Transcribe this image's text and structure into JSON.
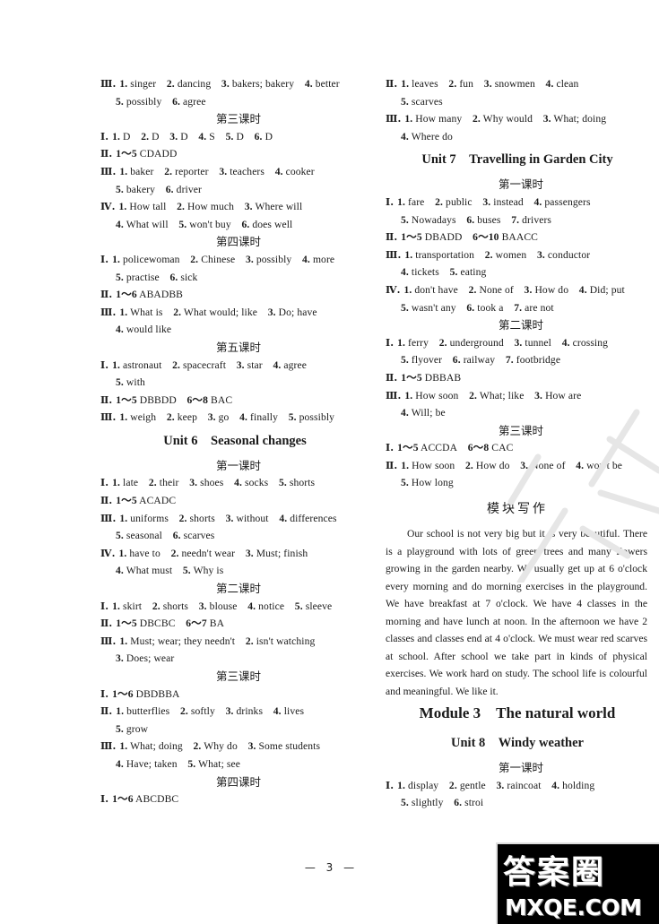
{
  "left": [
    {
      "type": "line",
      "roman": "Ⅲ",
      "items": [
        [
          "1.",
          "singer"
        ],
        [
          "2.",
          "dancing"
        ],
        [
          "3.",
          "bakers; bakery"
        ],
        [
          "4.",
          "better"
        ]
      ]
    },
    {
      "type": "cont",
      "items": [
        [
          "5.",
          "possibly"
        ],
        [
          "6.",
          "agree"
        ]
      ]
    },
    {
      "type": "lesson",
      "text": "第三课时"
    },
    {
      "type": "line",
      "roman": "Ⅰ",
      "items": [
        [
          "1.",
          "D"
        ],
        [
          "2.",
          "D"
        ],
        [
          "3.",
          "D"
        ],
        [
          "4.",
          "S"
        ],
        [
          "5.",
          "D"
        ],
        [
          "6.",
          "D"
        ]
      ]
    },
    {
      "type": "line",
      "roman": "Ⅱ",
      "items": [
        [
          "1～5",
          "CDADD"
        ]
      ]
    },
    {
      "type": "line",
      "roman": "Ⅲ",
      "items": [
        [
          "1.",
          "baker"
        ],
        [
          "2.",
          "reporter"
        ],
        [
          "3.",
          "teachers"
        ],
        [
          "4.",
          "cooker"
        ]
      ]
    },
    {
      "type": "cont",
      "items": [
        [
          "5.",
          "bakery"
        ],
        [
          "6.",
          "driver"
        ]
      ]
    },
    {
      "type": "line",
      "roman": "Ⅳ",
      "items": [
        [
          "1.",
          "How tall"
        ],
        [
          "2.",
          "How much"
        ],
        [
          "3.",
          "Where will"
        ]
      ]
    },
    {
      "type": "cont",
      "items": [
        [
          "4.",
          "What will"
        ],
        [
          "5.",
          "won't buy"
        ],
        [
          "6.",
          "does well"
        ]
      ]
    },
    {
      "type": "lesson",
      "text": "第四课时"
    },
    {
      "type": "line",
      "roman": "Ⅰ",
      "items": [
        [
          "1.",
          "policewoman"
        ],
        [
          "2.",
          "Chinese"
        ],
        [
          "3.",
          "possibly"
        ],
        [
          "4.",
          "more"
        ]
      ]
    },
    {
      "type": "cont",
      "items": [
        [
          "5.",
          "practise"
        ],
        [
          "6.",
          "sick"
        ]
      ]
    },
    {
      "type": "line",
      "roman": "Ⅱ",
      "items": [
        [
          "1～6",
          "ABADBB"
        ]
      ]
    },
    {
      "type": "line",
      "roman": "Ⅲ",
      "items": [
        [
          "1.",
          "What is"
        ],
        [
          "2.",
          "What would; like"
        ],
        [
          "3.",
          "Do; have"
        ]
      ]
    },
    {
      "type": "cont",
      "items": [
        [
          "4.",
          "would like"
        ]
      ]
    },
    {
      "type": "lesson",
      "text": "第五课时"
    },
    {
      "type": "line",
      "roman": "Ⅰ",
      "items": [
        [
          "1.",
          "astronaut"
        ],
        [
          "2.",
          "spacecraft"
        ],
        [
          "3.",
          "star"
        ],
        [
          "4.",
          "agree"
        ]
      ]
    },
    {
      "type": "cont",
      "items": [
        [
          "5.",
          "with"
        ]
      ]
    },
    {
      "type": "line",
      "roman": "Ⅱ",
      "items": [
        [
          "1～5",
          "DBBDD"
        ],
        [
          "6～8",
          "BAC"
        ]
      ]
    },
    {
      "type": "line",
      "roman": "Ⅲ",
      "items": [
        [
          "1.",
          "weigh"
        ],
        [
          "2.",
          "keep"
        ],
        [
          "3.",
          "go"
        ],
        [
          "4.",
          "finally"
        ],
        [
          "5.",
          "possibly"
        ]
      ]
    },
    {
      "type": "unit",
      "text": "Unit 6　Seasonal changes"
    },
    {
      "type": "lesson",
      "text": "第一课时"
    },
    {
      "type": "line",
      "roman": "Ⅰ",
      "items": [
        [
          "1.",
          "late"
        ],
        [
          "2.",
          "their"
        ],
        [
          "3.",
          "shoes"
        ],
        [
          "4.",
          "socks"
        ],
        [
          "5.",
          "shorts"
        ]
      ]
    },
    {
      "type": "line",
      "roman": "Ⅱ",
      "items": [
        [
          "1～5",
          "ACADC"
        ]
      ]
    },
    {
      "type": "line",
      "roman": "Ⅲ",
      "items": [
        [
          "1.",
          "uniforms"
        ],
        [
          "2.",
          "shorts"
        ],
        [
          "3.",
          "without"
        ],
        [
          "4.",
          "differences"
        ]
      ]
    },
    {
      "type": "cont",
      "items": [
        [
          "5.",
          "seasonal"
        ],
        [
          "6.",
          "scarves"
        ]
      ]
    },
    {
      "type": "line",
      "roman": "Ⅳ",
      "items": [
        [
          "1.",
          "have to"
        ],
        [
          "2.",
          "needn't wear"
        ],
        [
          "3.",
          "Must; finish"
        ]
      ]
    },
    {
      "type": "cont",
      "items": [
        [
          "4.",
          "What must"
        ],
        [
          "5.",
          "Why is"
        ]
      ]
    },
    {
      "type": "lesson",
      "text": "第二课时"
    },
    {
      "type": "line",
      "roman": "Ⅰ",
      "items": [
        [
          "1.",
          "skirt"
        ],
        [
          "2.",
          "shorts"
        ],
        [
          "3.",
          "blouse"
        ],
        [
          "4.",
          "notice"
        ],
        [
          "5.",
          "sleeve"
        ]
      ]
    },
    {
      "type": "line",
      "roman": "Ⅱ",
      "items": [
        [
          "1～5",
          "DBCBC"
        ],
        [
          "6～7",
          "BA"
        ]
      ]
    },
    {
      "type": "line",
      "roman": "Ⅲ",
      "items": [
        [
          "1.",
          "Must; wear; they needn't"
        ],
        [
          "2.",
          "isn't watching"
        ]
      ]
    },
    {
      "type": "cont",
      "items": [
        [
          "3.",
          "Does; wear"
        ]
      ]
    },
    {
      "type": "lesson",
      "text": "第三课时"
    },
    {
      "type": "line",
      "roman": "Ⅰ",
      "items": [
        [
          "1～6",
          "DBDBBA"
        ]
      ]
    },
    {
      "type": "line",
      "roman": "Ⅱ",
      "items": [
        [
          "1.",
          "butterflies"
        ],
        [
          "2.",
          "softly"
        ],
        [
          "3.",
          "drinks"
        ],
        [
          "4.",
          "lives"
        ]
      ]
    },
    {
      "type": "cont",
      "items": [
        [
          "5.",
          "grow"
        ]
      ]
    },
    {
      "type": "line",
      "roman": "Ⅲ",
      "items": [
        [
          "1.",
          "What; doing"
        ],
        [
          "2.",
          "Why do"
        ],
        [
          "3.",
          "Some students"
        ]
      ]
    },
    {
      "type": "cont",
      "items": [
        [
          "4.",
          "Have; taken"
        ],
        [
          "5.",
          "What; see"
        ]
      ]
    },
    {
      "type": "lesson",
      "text": "第四课时"
    },
    {
      "type": "line",
      "roman": "Ⅰ",
      "items": [
        [
          "1～6",
          "ABCDBC"
        ]
      ]
    }
  ],
  "right": [
    {
      "type": "line",
      "roman": "Ⅱ",
      "items": [
        [
          "1.",
          "leaves"
        ],
        [
          "2.",
          "fun"
        ],
        [
          "3.",
          "snowmen"
        ],
        [
          "4.",
          "clean"
        ]
      ]
    },
    {
      "type": "cont",
      "items": [
        [
          "5.",
          "scarves"
        ]
      ]
    },
    {
      "type": "line",
      "roman": "Ⅲ",
      "items": [
        [
          "1.",
          "How many"
        ],
        [
          "2.",
          "Why would"
        ],
        [
          "3.",
          "What; doing"
        ]
      ]
    },
    {
      "type": "cont",
      "items": [
        [
          "4.",
          "Where do"
        ]
      ]
    },
    {
      "type": "unit",
      "text": "Unit 7　Travelling in Garden City"
    },
    {
      "type": "lesson",
      "text": "第一课时"
    },
    {
      "type": "line",
      "roman": "Ⅰ",
      "items": [
        [
          "1.",
          "fare"
        ],
        [
          "2.",
          "public"
        ],
        [
          "3.",
          "instead"
        ],
        [
          "4.",
          "passengers"
        ]
      ]
    },
    {
      "type": "cont",
      "items": [
        [
          "5.",
          "Nowadays"
        ],
        [
          "6.",
          "buses"
        ],
        [
          "7.",
          "drivers"
        ]
      ]
    },
    {
      "type": "line",
      "roman": "Ⅱ",
      "items": [
        [
          "1～5",
          "DBADD"
        ],
        [
          "6～10",
          "BAACC"
        ]
      ]
    },
    {
      "type": "line",
      "roman": "Ⅲ",
      "items": [
        [
          "1.",
          "transportation"
        ],
        [
          "2.",
          "women"
        ],
        [
          "3.",
          "conductor"
        ]
      ]
    },
    {
      "type": "cont",
      "items": [
        [
          "4.",
          "tickets"
        ],
        [
          "5.",
          "eating"
        ]
      ]
    },
    {
      "type": "line",
      "roman": "Ⅳ",
      "items": [
        [
          "1.",
          "don't have"
        ],
        [
          "2.",
          "None of"
        ],
        [
          "3.",
          "How do"
        ],
        [
          "4.",
          "Did; put"
        ]
      ]
    },
    {
      "type": "cont",
      "items": [
        [
          "5.",
          "wasn't any"
        ],
        [
          "6.",
          "took a"
        ],
        [
          "7.",
          "are not"
        ]
      ]
    },
    {
      "type": "lesson",
      "text": "第二课时"
    },
    {
      "type": "line",
      "roman": "Ⅰ",
      "items": [
        [
          "1.",
          "ferry"
        ],
        [
          "2.",
          "underground"
        ],
        [
          "3.",
          "tunnel"
        ],
        [
          "4.",
          "crossing"
        ]
      ]
    },
    {
      "type": "cont",
      "items": [
        [
          "5.",
          "flyover"
        ],
        [
          "6.",
          "railway"
        ],
        [
          "7.",
          "footbridge"
        ]
      ]
    },
    {
      "type": "line",
      "roman": "Ⅱ",
      "items": [
        [
          "1～5",
          "DBBAB"
        ]
      ]
    },
    {
      "type": "line",
      "roman": "Ⅲ",
      "items": [
        [
          "1.",
          "How soon"
        ],
        [
          "2.",
          "What; like"
        ],
        [
          "3.",
          "How are"
        ]
      ]
    },
    {
      "type": "cont",
      "items": [
        [
          "4.",
          "Will; be"
        ]
      ]
    },
    {
      "type": "lesson",
      "text": "第三课时"
    },
    {
      "type": "line",
      "roman": "Ⅰ",
      "items": [
        [
          "1～5",
          "ACCDA"
        ],
        [
          "6～8",
          "CAC"
        ]
      ]
    },
    {
      "type": "line",
      "roman": "Ⅱ",
      "items": [
        [
          "1.",
          "How soon"
        ],
        [
          "2.",
          "How do"
        ],
        [
          "3.",
          "None of"
        ],
        [
          "4.",
          "won't be"
        ]
      ]
    },
    {
      "type": "cont",
      "items": [
        [
          "5.",
          "How long"
        ]
      ]
    },
    {
      "type": "writing",
      "text": "模块写作"
    },
    {
      "type": "para",
      "text": "Our school is not very big but it is very beautiful. There is a playground with lots of green trees and many flowers growing in the garden nearby. We usually get up at 6 o'clock every morning and do morning exercises in the playground. We have breakfast at 7 o'clock. We have 4 classes in the morning and have lunch at noon. In the afternoon we have 2 classes and classes end at 4 o'clock. We must wear red scarves at school. After school we take part in kinds of physical exercises. We work hard on study. The school life is colourful and meaningful. We like it."
    },
    {
      "type": "module",
      "text": "Module 3　The natural world"
    },
    {
      "type": "unit",
      "text": "Unit 8　Windy weather"
    },
    {
      "type": "lesson",
      "text": "第一课时"
    },
    {
      "type": "line",
      "roman": "Ⅰ",
      "items": [
        [
          "1.",
          "display"
        ],
        [
          "2.",
          "gentle"
        ],
        [
          "3.",
          "raincoat"
        ],
        [
          "4.",
          "holding"
        ]
      ]
    },
    {
      "type": "cont",
      "items": [
        [
          "5.",
          "slightly"
        ],
        [
          "6.",
          "stroi"
        ]
      ]
    }
  ],
  "page_number": "— 3 —",
  "watermark": {
    "cn": "答案圈",
    "en": "MXQE.COM"
  }
}
